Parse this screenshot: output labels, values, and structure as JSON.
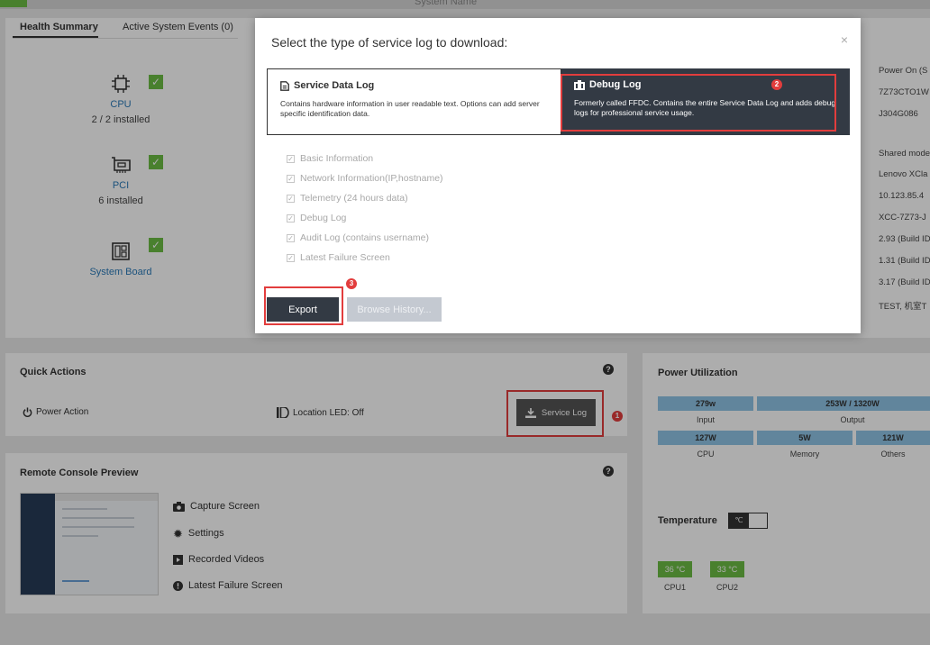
{
  "header": {
    "title": "System Name"
  },
  "health": {
    "tabs": [
      "Health Summary",
      "Active System Events (0)"
    ],
    "components": [
      {
        "name": "CPU",
        "count": "2 / 2 installed",
        "icon": "cpu-icon"
      },
      {
        "name": "PCI",
        "count": "6 installed",
        "icon": "pci-card-icon"
      },
      {
        "name": "System Board",
        "count": "",
        "icon": "system-board-icon"
      }
    ],
    "check_glyph": "✓",
    "info_col": [
      "Power On (S",
      "7Z73CTO1W",
      "J304G086",
      "Shared mode",
      "Lenovo XCla",
      "10.123.85.4",
      "XCC-7Z73-J",
      "2.93 (Build ID",
      "1.31 (Build ID",
      "3.17 (Build ID",
      "TEST, 机室T"
    ]
  },
  "quick_actions": {
    "title": "Quick Actions",
    "help": "?",
    "power_action": "Power Action",
    "location_led": "Location LED: Off",
    "service_log_btn": "Service Log",
    "badge": "1"
  },
  "remote_console": {
    "title": "Remote Console Preview",
    "help": "?",
    "items": [
      "Capture Screen",
      "Settings",
      "Recorded Videos",
      "Latest Failure Screen"
    ]
  },
  "power": {
    "title": "Power Utilization",
    "input_val": "279w",
    "input_lbl": "Input",
    "output_val": "253W / 1320W",
    "output_lbl": "Output",
    "cpu_val": "127W",
    "cpu_lbl": "CPU",
    "mem_val": "5W",
    "mem_lbl": "Memory",
    "others_val": "121W",
    "others_lbl": "Others"
  },
  "temperature": {
    "title": "Temperature",
    "unit": "℃",
    "cpu1_val": "36 °C",
    "cpu1_lbl": "CPU1",
    "cpu2_val": "33 °C",
    "cpu2_lbl": "CPU2"
  },
  "modal": {
    "title": "Select the type of service log to download:",
    "close": "×",
    "service_title": "Service Data Log",
    "service_desc": "Contains hardware information in user readable text. Options can add server specific identification data.",
    "debug_title": "Debug Log",
    "debug_desc": "Formerly called FFDC. Contains the entire Service Data Log and adds debug logs for professional service usage.",
    "debug_badge": "2",
    "checkbox_glyph": "✓",
    "checkboxes": [
      "Basic Information",
      "Network Information(IP,hostname)",
      "Telemetry (24 hours data)",
      "Debug Log",
      "Audit Log (contains username)",
      "Latest Failure Screen"
    ],
    "export_label": "Export",
    "export_badge": "3",
    "browse_label": "Browse History..."
  },
  "colors": {
    "accent_green": "#6cbd45",
    "dark": "#333a44",
    "highlight_red": "#e23d3d",
    "link_blue": "#2a7ab8",
    "power_blue": "#8fc4e6"
  }
}
